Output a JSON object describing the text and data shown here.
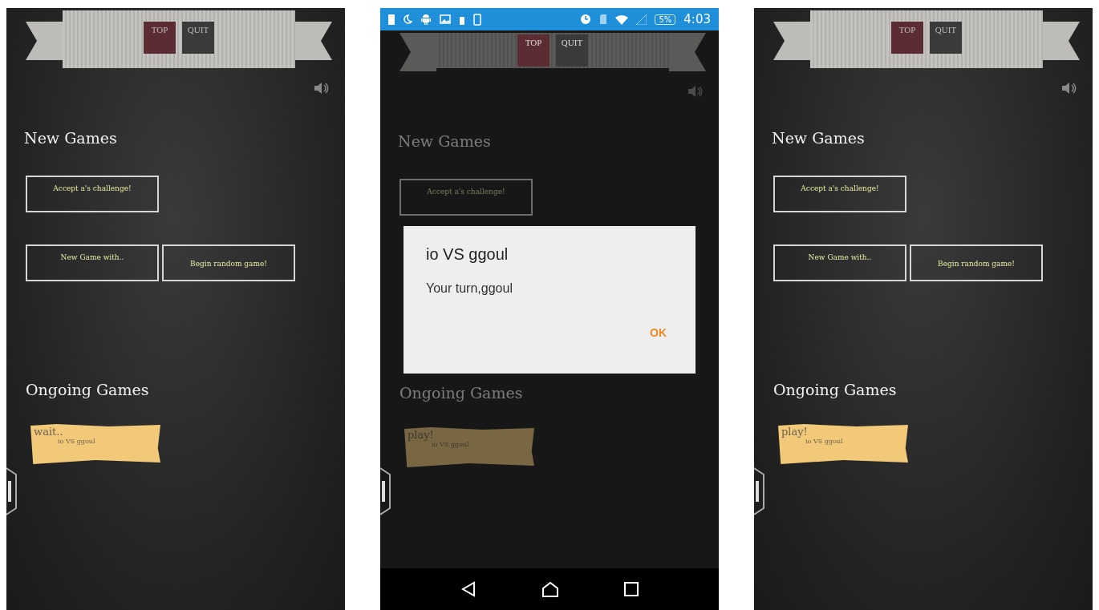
{
  "screens": [
    {
      "kind": "plain",
      "banner_buttons": [
        {
          "label": "TOP",
          "color": "#5b2c31"
        },
        {
          "label": "QUIT",
          "color": "#3b3a3a"
        }
      ],
      "new_games_heading": "New Games",
      "accept_button": "Accept a's challenge!",
      "row_buttons": [
        "New Game with..",
        "Begin random game!"
      ],
      "ongoing_heading": "Ongoing Games",
      "game": {
        "status": "wait..",
        "match": "io VS ggoul"
      }
    },
    {
      "kind": "dialog",
      "status_bar": {
        "battery": "5%",
        "time": "4:03"
      },
      "banner_buttons": [
        {
          "label": "TOP",
          "color": "#5b2c31"
        },
        {
          "label": "QUIT",
          "color": "#3b3a3a"
        }
      ],
      "new_games_heading": "New Games",
      "accept_button": "Accept a's challenge!",
      "ongoing_heading": "Ongoing Games",
      "game": {
        "status": "play!",
        "match": "io VS ggoul"
      },
      "dialog": {
        "title": "io VS ggoul",
        "message": "Your turn,ggoul",
        "button": "OK"
      }
    },
    {
      "kind": "plain",
      "banner_buttons": [
        {
          "label": "TOP",
          "color": "#5b2c31"
        },
        {
          "label": "QUIT",
          "color": "#3b3a3a"
        }
      ],
      "new_games_heading": "New Games",
      "accept_button": "Accept a's challenge!",
      "row_buttons": [
        "New Game with..",
        "Begin random game!"
      ],
      "ongoing_heading": "Ongoing Games",
      "game": {
        "status": "play!",
        "match": "io VS ggoul"
      }
    }
  ]
}
